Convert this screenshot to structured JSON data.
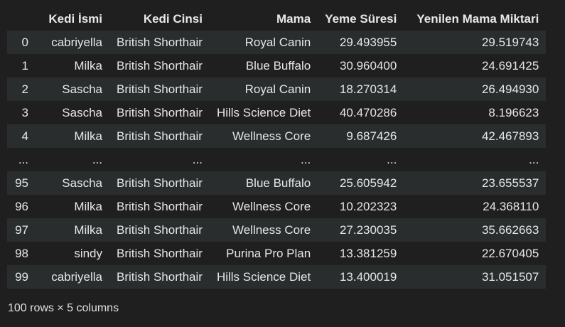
{
  "table": {
    "columns": [
      "",
      "Kedi İsmi",
      "Kedi Cinsi",
      "Mama",
      "Yeme Süresi",
      "Yenilen Mama Miktari"
    ],
    "rows": [
      [
        "0",
        "cabriyella",
        "British Shorthair",
        "Royal Canin",
        "29.493955",
        "29.519743"
      ],
      [
        "1",
        "Milka",
        "British Shorthair",
        "Blue Buffalo",
        "30.960400",
        "24.691425"
      ],
      [
        "2",
        "Sascha",
        "British Shorthair",
        "Royal Canin",
        "18.270314",
        "26.494930"
      ],
      [
        "3",
        "Sascha",
        "British Shorthair",
        "Hills Science Diet",
        "40.470286",
        "8.196623"
      ],
      [
        "4",
        "Milka",
        "British Shorthair",
        "Wellness Core",
        "9.687426",
        "42.467893"
      ],
      [
        "...",
        "...",
        "...",
        "...",
        "...",
        "..."
      ],
      [
        "95",
        "Sascha",
        "British Shorthair",
        "Blue Buffalo",
        "25.605942",
        "23.655537"
      ],
      [
        "96",
        "Milka",
        "British Shorthair",
        "Wellness Core",
        "10.202323",
        "24.368110"
      ],
      [
        "97",
        "Milka",
        "British Shorthair",
        "Wellness Core",
        "27.230035",
        "35.662663"
      ],
      [
        "98",
        "sindy",
        "British Shorthair",
        "Purina Pro Plan",
        "13.381259",
        "22.670405"
      ],
      [
        "99",
        "cabriyella",
        "British Shorthair",
        "Hills Science Diet",
        "13.400019",
        "31.051507"
      ]
    ]
  },
  "shape_info": "100 rows × 5 columns"
}
